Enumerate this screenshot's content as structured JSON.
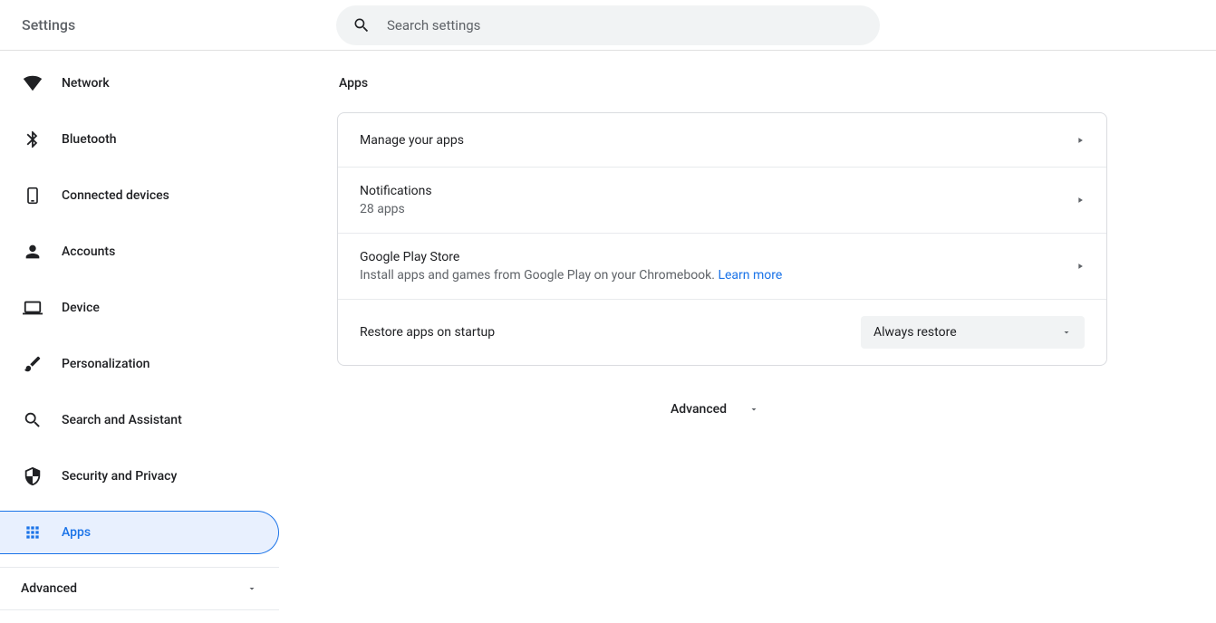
{
  "header": {
    "title": "Settings",
    "search_placeholder": "Search settings"
  },
  "sidebar": {
    "items": [
      {
        "label": "Network",
        "icon": "wifi-icon"
      },
      {
        "label": "Bluetooth",
        "icon": "bluetooth-icon"
      },
      {
        "label": "Connected devices",
        "icon": "devices-icon"
      },
      {
        "label": "Accounts",
        "icon": "person-icon"
      },
      {
        "label": "Device",
        "icon": "laptop-icon"
      },
      {
        "label": "Personalization",
        "icon": "brush-icon"
      },
      {
        "label": "Search and Assistant",
        "icon": "search-icon"
      },
      {
        "label": "Security and Privacy",
        "icon": "security-icon"
      },
      {
        "label": "Apps",
        "icon": "apps-icon"
      }
    ],
    "advanced": "Advanced"
  },
  "main": {
    "title": "Apps",
    "rows": {
      "manage": {
        "title": "Manage your apps"
      },
      "notifications": {
        "title": "Notifications",
        "subtitle": "28 apps"
      },
      "playstore": {
        "title": "Google Play Store",
        "subtitle": "Install apps and games from Google Play on your Chromebook. ",
        "link": "Learn more"
      },
      "restore": {
        "title": "Restore apps on startup",
        "dropdown_value": "Always restore"
      }
    },
    "advanced": "Advanced"
  }
}
